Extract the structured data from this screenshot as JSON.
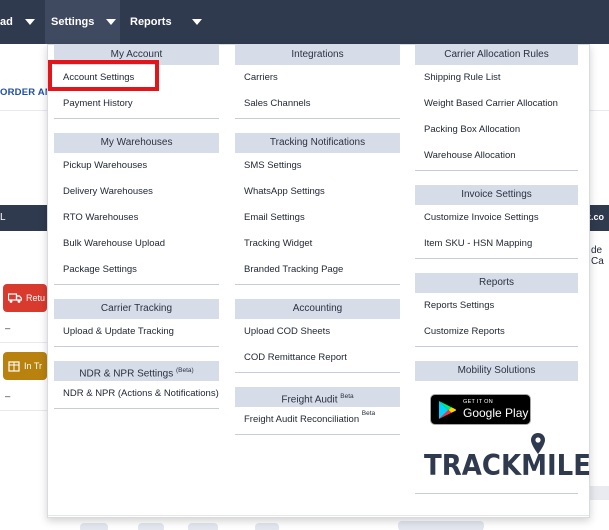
{
  "navbar": {
    "items": [
      {
        "label": "ad"
      },
      {
        "label": "Settings"
      },
      {
        "label": "Reports"
      }
    ]
  },
  "background": {
    "link_left": "ORDER ANA",
    "bar_left_char": "L",
    "bar_right_text": "iz.co",
    "side_text_right": "de Ca",
    "chip_return": "Retu",
    "chip_transit": "In Tr",
    "dash_1": "–",
    "dash_2": "–"
  },
  "menu": {
    "col1": [
      {
        "header": "My Account",
        "links": [
          "Account Settings",
          "Payment History"
        ]
      },
      {
        "header": "My Warehouses",
        "links": [
          "Pickup Warehouses",
          "Delivery Warehouses",
          "RTO Warehouses",
          "Bulk Warehouse Upload",
          "Package Settings"
        ]
      },
      {
        "header": "Carrier Tracking",
        "links": [
          "Upload & Update Tracking"
        ]
      },
      {
        "header": "NDR & NPR Settings",
        "header_badge": "(Beta)",
        "links": [
          "NDR & NPR (Actions & Notifications)"
        ]
      }
    ],
    "col2": [
      {
        "header": "Integrations",
        "links": [
          "Carriers",
          "Sales Channels"
        ]
      },
      {
        "header": "Tracking Notifications",
        "links": [
          "SMS Settings",
          "WhatsApp Settings",
          "Email Settings",
          "Tracking Widget",
          "Branded Tracking Page"
        ]
      },
      {
        "header": "Accounting",
        "links": [
          "Upload COD Sheets",
          "COD Remittance Report"
        ]
      },
      {
        "header": "Freight Audit",
        "header_badge": "Beta",
        "links": [
          "Freight Audit Reconciliation"
        ],
        "link_badge": "Beta"
      }
    ],
    "col3": [
      {
        "header": "Carrier Allocation Rules",
        "links": [
          "Shipping Rule List",
          "Weight Based Carrier Allocation",
          "Packing Box Allocation",
          "Warehouse Allocation"
        ]
      },
      {
        "header": "Invoice Settings",
        "links": [
          "Customize Invoice Settings",
          "Item SKU - HSN Mapping"
        ]
      },
      {
        "header": "Reports",
        "links": [
          "Reports Settings",
          "Customize Reports"
        ]
      },
      {
        "header": "Mobility Solutions"
      }
    ]
  },
  "badges": {
    "google_play_small": "GET IT ON",
    "google_play_big": "Google Play",
    "trackmile": "TRACKMILE"
  },
  "colors": {
    "navbar": "#2f3a4f",
    "section_header": "#d7dde8",
    "highlight": "#e3151b",
    "chip_red": "#d93a2e",
    "chip_gold": "#b9820f"
  }
}
